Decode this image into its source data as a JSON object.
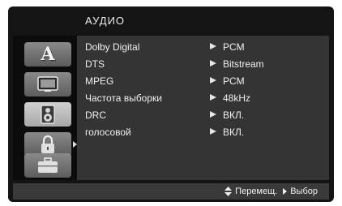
{
  "header": {
    "title": "АУДИО"
  },
  "sidebar": {
    "items": [
      {
        "icon": "language-icon",
        "glyph": "A",
        "selected": false
      },
      {
        "icon": "display-icon",
        "selected": false
      },
      {
        "icon": "speaker-icon",
        "selected": true
      },
      {
        "icon": "lock-icon",
        "selected": false
      },
      {
        "icon": "briefcase-icon",
        "selected": false
      }
    ]
  },
  "settings": [
    {
      "label": "Dolby Digital",
      "value": "PCM"
    },
    {
      "label": "DTS",
      "value": "Bitstream"
    },
    {
      "label": "MPEG",
      "value": "PCM"
    },
    {
      "label": "Частота выборки",
      "value": "48kHz"
    },
    {
      "label": "DRC",
      "value": "ВКЛ."
    },
    {
      "label": "голосовой",
      "value": "ВКЛ."
    }
  ],
  "footer": {
    "move_label": "Перемещ.",
    "select_label": "Выбор"
  }
}
